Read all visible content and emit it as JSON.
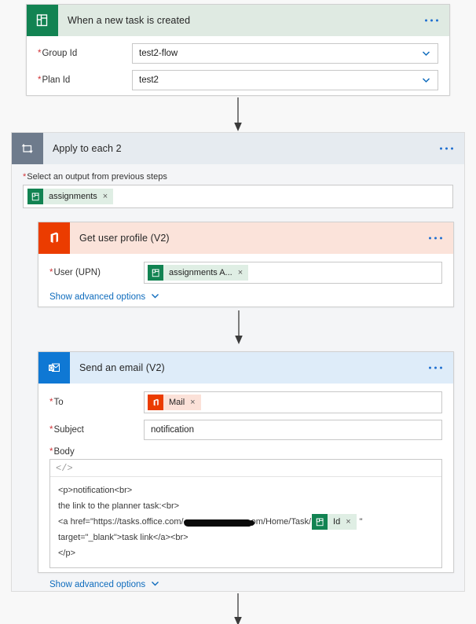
{
  "flow": {
    "trigger": {
      "title": "When a new task is created",
      "icon": "planner-icon",
      "menu": "more-options",
      "fields": [
        {
          "label": "Group Id",
          "required": true,
          "value": "test2-flow",
          "control": "dropdown"
        },
        {
          "label": "Plan Id",
          "required": true,
          "value": "test2",
          "control": "dropdown"
        }
      ]
    },
    "loop": {
      "title": "Apply to each 2",
      "icon": "loop-icon",
      "select_label": "Select an output from previous steps",
      "select_required": true,
      "token": {
        "text": "assignments",
        "icon": "planner-icon",
        "remove": "×"
      },
      "actions": [
        {
          "title": "Get user profile (V2)",
          "icon": "office365-icon",
          "fields": [
            {
              "label": "User (UPN)",
              "required": true,
              "token": {
                "text": "assignments A...",
                "icon": "planner-icon",
                "remove": "×"
              }
            }
          ],
          "advanced_label": "Show advanced options"
        },
        {
          "title": "Send an email (V2)",
          "icon": "outlook-icon",
          "fields": [
            {
              "label": "To",
              "required": true,
              "token": {
                "text": "Mail",
                "icon": "office365-icon",
                "remove": "×"
              }
            },
            {
              "label": "Subject",
              "required": true,
              "value": "notification"
            }
          ],
          "body_label": "Body",
          "body_required": true,
          "body_toolbar_icon": "</>",
          "body_lines": [
            "<p>notification<br>",
            "the link to the planner task:<br>",
            "target=\"_blank\">task link</a><br>",
            "</p>"
          ],
          "body_link_line": {
            "prefix": "<a href=\"https://tasks.office.com/",
            "redacted": true,
            "suffix": "om/Home/Task/",
            "token": {
              "text": "Id",
              "icon": "planner-icon",
              "remove": "×"
            },
            "trailing": "\""
          },
          "advanced_label": "Show advanced options"
        }
      ]
    }
  },
  "colors": {
    "planner_green": "#128352",
    "office_orange": "#eb3c00",
    "outlook_blue": "#0f78d4",
    "loop_gray": "#6e7b8c",
    "link_blue": "#0f6cbd",
    "required_red": "#d13438"
  }
}
